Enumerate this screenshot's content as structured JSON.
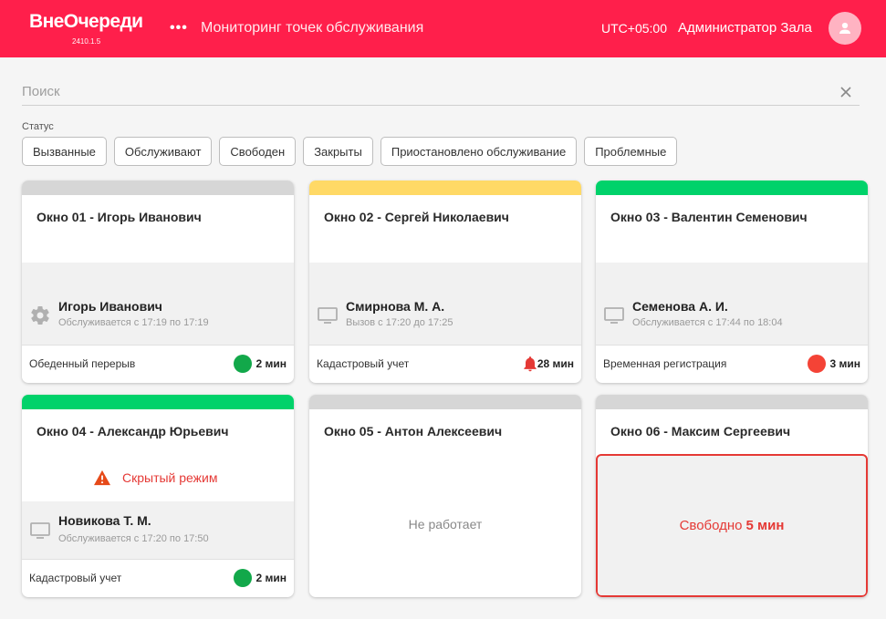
{
  "app": {
    "brand": "ВнеОчереди",
    "version": "2410.1.5",
    "page_title": "Мониторинг точек обслуживания",
    "timezone": "UTC+05:00",
    "user_name": "Администратор Зала"
  },
  "search": {
    "placeholder": "Поиск"
  },
  "filters": {
    "label": "Статус",
    "chips": [
      "Вызванные",
      "Обслуживают",
      "Свободен",
      "Закрыты",
      "Приостановлено обслуживание",
      "Проблемные"
    ]
  },
  "colors": {
    "brand": "#ff1f4b",
    "grey_status": "#d6d6d6",
    "yellow_status": "#ffd966",
    "green_status": "#00d26a",
    "green_dot": "#12a84a",
    "red": "#e53935"
  },
  "windows": [
    {
      "title": "Окно 01 - Игорь Иванович",
      "status_color": "#d6d6d6",
      "operator": "Игорь Иванович",
      "time": "Обслуживается с 17:19 по 17:19",
      "icon": "gear-icon",
      "service": "Обеденный перерыв",
      "indicator": "green-dot",
      "duration": "2 мин"
    },
    {
      "title": "Окно 02 - Сергей Николаевич",
      "status_color": "#ffd966",
      "operator": "Смирнова М. А.",
      "time": "Вызов с 17:20 до 17:25",
      "icon": "monitor-icon",
      "service": "Кадастровый учет",
      "indicator": "bell-icon",
      "duration": "28 мин"
    },
    {
      "title": "Окно 03 - Валентин Семенович",
      "status_color": "#00d26a",
      "operator": "Семенова А. И.",
      "time": "Обслуживается с 17:44 по 18:04",
      "icon": "monitor-icon",
      "service": "Временная регистрация",
      "indicator": "red-dot",
      "duration": "3 мин"
    },
    {
      "title": "Окно 04 - Александр Юрьевич",
      "status_color": "#00d26a",
      "warning": "Скрытый режим",
      "operator": "Новикова Т. М.",
      "time": "Обслуживается с 17:20 по 17:50",
      "icon": "monitor-icon",
      "service": "Кадастровый учет",
      "indicator": "green-dot",
      "duration": "2 мин"
    },
    {
      "title": "Окно 05 - Антон Алексеевич",
      "status_color": "#d6d6d6",
      "inactive_text": "Не работает"
    },
    {
      "title": "Окно 06 - Максим Сергеевич",
      "status_color": "#d6d6d6",
      "free_text": "Свободно",
      "free_duration": "5 мин"
    }
  ]
}
